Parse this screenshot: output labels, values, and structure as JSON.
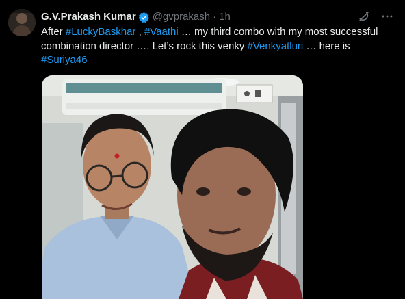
{
  "author": {
    "display_name": "G.V.Prakash Kumar",
    "handle": "@gvprakash",
    "separator": "·",
    "time": "1h"
  },
  "body_segments": [
    {
      "type": "text",
      "value": "After "
    },
    {
      "type": "hashtag",
      "value": "#LuckyBaskhar"
    },
    {
      "type": "text",
      "value": " , "
    },
    {
      "type": "hashtag",
      "value": "#Vaathi"
    },
    {
      "type": "text",
      "value": " … my third combo with my most successful combination director …. Let’s rock this venky "
    },
    {
      "type": "hashtag",
      "value": "#Venkyatluri"
    },
    {
      "type": "text",
      "value": " … here is "
    },
    {
      "type": "hashtag",
      "value": "#Suriya46"
    }
  ],
  "icons": {
    "verified": "verified-badge-icon",
    "grok": "grok-icon",
    "more": "more-icon"
  },
  "colors": {
    "background": "#000000",
    "text": "#e7e9ea",
    "secondary": "#71767b",
    "link": "#1d9bf0",
    "verified": "#1d9bf0"
  }
}
